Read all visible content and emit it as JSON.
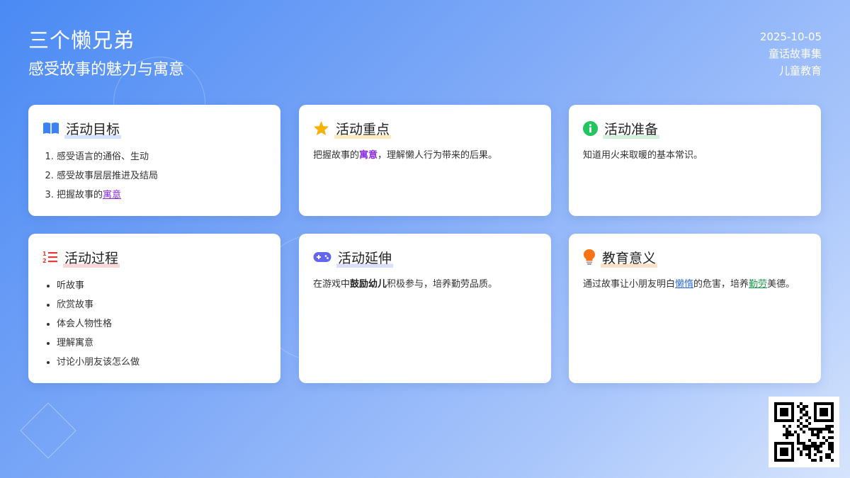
{
  "header": {
    "title": "三个懒兄弟",
    "subtitle": "感受故事的魅力与寓意",
    "date": "2025-10-05",
    "collection": "童话故事集",
    "category": "儿童教育"
  },
  "cards": {
    "goals": {
      "title": "活动目标",
      "icon": "book-icon",
      "items": [
        "感受语言的通俗、生动",
        "感受故事层层推进及结局"
      ],
      "item3_prefix": "把握故事的",
      "item3_link": "寓意"
    },
    "focus": {
      "title": "活动重点",
      "icon": "star-icon",
      "text_prefix": "把握故事的",
      "text_em": "寓意",
      "text_suffix": "，理解懒人行为带来的后果。"
    },
    "prep": {
      "title": "活动准备",
      "icon": "info-icon",
      "text": "知道用火来取暖的基本常识。"
    },
    "process": {
      "title": "活动过程",
      "icon": "numbered-list-icon",
      "items": [
        "听故事",
        "欣赏故事",
        "体会人物性格",
        "理解寓意",
        "讨论小朋友该怎么做"
      ]
    },
    "extension": {
      "title": "活动延伸",
      "icon": "gamepad-icon",
      "text_prefix": "在游戏中",
      "text_em": "鼓励幼儿",
      "text_suffix": "积极参与，培养勤劳品质。"
    },
    "meaning": {
      "title": "教育意义",
      "icon": "lightbulb-icon",
      "text_prefix": "通过故事让小朋友明白",
      "link1": "懒惰",
      "text_mid": "的危害，培养",
      "link2": "勤劳",
      "text_suffix": "美德。"
    }
  },
  "qr": {
    "icon": "qr-code"
  },
  "colors": {
    "bg_start": "#4a8af4",
    "bg_end": "#d6e4fd",
    "accent_purple": "#8a2be2",
    "accent_blue": "#2d6bd9",
    "accent_green": "#1f9d4a"
  }
}
